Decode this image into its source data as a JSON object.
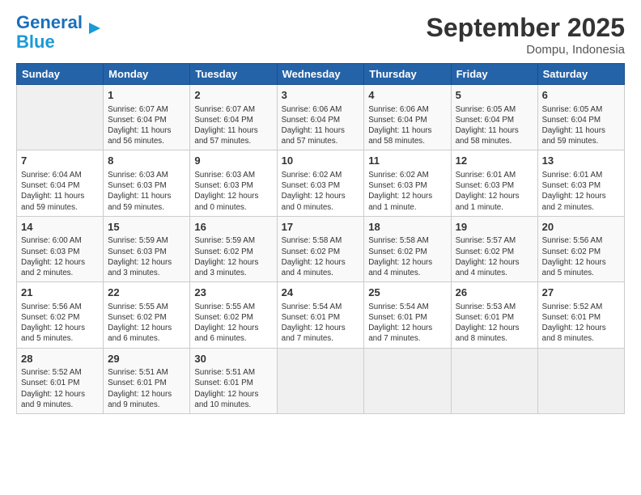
{
  "header": {
    "logo_line1": "General",
    "logo_line2": "Blue",
    "month_title": "September 2025",
    "location": "Dompu, Indonesia"
  },
  "weekdays": [
    "Sunday",
    "Monday",
    "Tuesday",
    "Wednesday",
    "Thursday",
    "Friday",
    "Saturday"
  ],
  "weeks": [
    [
      {
        "day": "",
        "info": ""
      },
      {
        "day": "1",
        "info": "Sunrise: 6:07 AM\nSunset: 6:04 PM\nDaylight: 11 hours\nand 56 minutes."
      },
      {
        "day": "2",
        "info": "Sunrise: 6:07 AM\nSunset: 6:04 PM\nDaylight: 11 hours\nand 57 minutes."
      },
      {
        "day": "3",
        "info": "Sunrise: 6:06 AM\nSunset: 6:04 PM\nDaylight: 11 hours\nand 57 minutes."
      },
      {
        "day": "4",
        "info": "Sunrise: 6:06 AM\nSunset: 6:04 PM\nDaylight: 11 hours\nand 58 minutes."
      },
      {
        "day": "5",
        "info": "Sunrise: 6:05 AM\nSunset: 6:04 PM\nDaylight: 11 hours\nand 58 minutes."
      },
      {
        "day": "6",
        "info": "Sunrise: 6:05 AM\nSunset: 6:04 PM\nDaylight: 11 hours\nand 59 minutes."
      }
    ],
    [
      {
        "day": "7",
        "info": "Sunrise: 6:04 AM\nSunset: 6:04 PM\nDaylight: 11 hours\nand 59 minutes."
      },
      {
        "day": "8",
        "info": "Sunrise: 6:03 AM\nSunset: 6:03 PM\nDaylight: 11 hours\nand 59 minutes."
      },
      {
        "day": "9",
        "info": "Sunrise: 6:03 AM\nSunset: 6:03 PM\nDaylight: 12 hours\nand 0 minutes."
      },
      {
        "day": "10",
        "info": "Sunrise: 6:02 AM\nSunset: 6:03 PM\nDaylight: 12 hours\nand 0 minutes."
      },
      {
        "day": "11",
        "info": "Sunrise: 6:02 AM\nSunset: 6:03 PM\nDaylight: 12 hours\nand 1 minute."
      },
      {
        "day": "12",
        "info": "Sunrise: 6:01 AM\nSunset: 6:03 PM\nDaylight: 12 hours\nand 1 minute."
      },
      {
        "day": "13",
        "info": "Sunrise: 6:01 AM\nSunset: 6:03 PM\nDaylight: 12 hours\nand 2 minutes."
      }
    ],
    [
      {
        "day": "14",
        "info": "Sunrise: 6:00 AM\nSunset: 6:03 PM\nDaylight: 12 hours\nand 2 minutes."
      },
      {
        "day": "15",
        "info": "Sunrise: 5:59 AM\nSunset: 6:03 PM\nDaylight: 12 hours\nand 3 minutes."
      },
      {
        "day": "16",
        "info": "Sunrise: 5:59 AM\nSunset: 6:02 PM\nDaylight: 12 hours\nand 3 minutes."
      },
      {
        "day": "17",
        "info": "Sunrise: 5:58 AM\nSunset: 6:02 PM\nDaylight: 12 hours\nand 4 minutes."
      },
      {
        "day": "18",
        "info": "Sunrise: 5:58 AM\nSunset: 6:02 PM\nDaylight: 12 hours\nand 4 minutes."
      },
      {
        "day": "19",
        "info": "Sunrise: 5:57 AM\nSunset: 6:02 PM\nDaylight: 12 hours\nand 4 minutes."
      },
      {
        "day": "20",
        "info": "Sunrise: 5:56 AM\nSunset: 6:02 PM\nDaylight: 12 hours\nand 5 minutes."
      }
    ],
    [
      {
        "day": "21",
        "info": "Sunrise: 5:56 AM\nSunset: 6:02 PM\nDaylight: 12 hours\nand 5 minutes."
      },
      {
        "day": "22",
        "info": "Sunrise: 5:55 AM\nSunset: 6:02 PM\nDaylight: 12 hours\nand 6 minutes."
      },
      {
        "day": "23",
        "info": "Sunrise: 5:55 AM\nSunset: 6:02 PM\nDaylight: 12 hours\nand 6 minutes."
      },
      {
        "day": "24",
        "info": "Sunrise: 5:54 AM\nSunset: 6:01 PM\nDaylight: 12 hours\nand 7 minutes."
      },
      {
        "day": "25",
        "info": "Sunrise: 5:54 AM\nSunset: 6:01 PM\nDaylight: 12 hours\nand 7 minutes."
      },
      {
        "day": "26",
        "info": "Sunrise: 5:53 AM\nSunset: 6:01 PM\nDaylight: 12 hours\nand 8 minutes."
      },
      {
        "day": "27",
        "info": "Sunrise: 5:52 AM\nSunset: 6:01 PM\nDaylight: 12 hours\nand 8 minutes."
      }
    ],
    [
      {
        "day": "28",
        "info": "Sunrise: 5:52 AM\nSunset: 6:01 PM\nDaylight: 12 hours\nand 9 minutes."
      },
      {
        "day": "29",
        "info": "Sunrise: 5:51 AM\nSunset: 6:01 PM\nDaylight: 12 hours\nand 9 minutes."
      },
      {
        "day": "30",
        "info": "Sunrise: 5:51 AM\nSunset: 6:01 PM\nDaylight: 12 hours\nand 10 minutes."
      },
      {
        "day": "",
        "info": ""
      },
      {
        "day": "",
        "info": ""
      },
      {
        "day": "",
        "info": ""
      },
      {
        "day": "",
        "info": ""
      }
    ]
  ]
}
